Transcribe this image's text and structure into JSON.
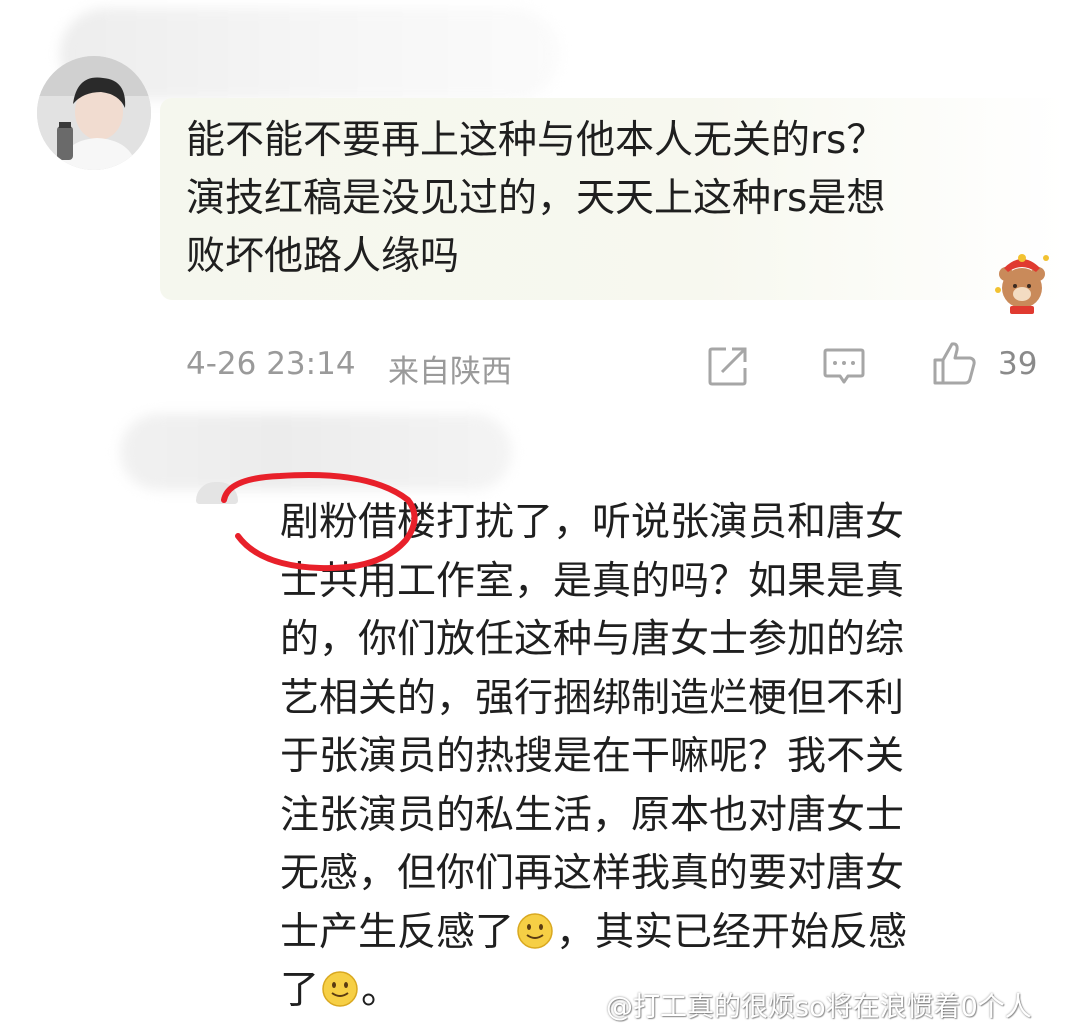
{
  "comments": [
    {
      "text": "能不能不要再上这种与他本人无关的rs？\n演技红稿是没见过的，天天上这种rs是想\n败坏他路人缘吗",
      "timestamp": "4-26 23:14",
      "location": "来自陕西",
      "like_count": "39",
      "icons": [
        "share-icon",
        "reply-icon",
        "like-icon",
        "bear-sticker-icon"
      ]
    },
    {
      "text_parts": [
        "剧粉借楼打扰了，听说张演员和唐女\n士共用工作室，是真的吗？如果是真\n的，你们放任这种与唐女士参加的综\n艺相关的，强行捆绑制造烂梗但不利\n于张演员的热搜是在干嘛呢？我不关\n注张演员的私生活，原本也对唐女士\n无感，但你们再这样我真的要对唐女\n士产生反感了",
        "，其实已经开始反感\n了",
        "。"
      ],
      "icons": [
        "smiley-icon"
      ]
    }
  ],
  "watermark": "@打工真的很烦so将在浪惯着0个人",
  "colors": {
    "bubble": "#f5f7ee",
    "meta_text": "#9a9a9a",
    "annotation_red": "#e8202a"
  }
}
